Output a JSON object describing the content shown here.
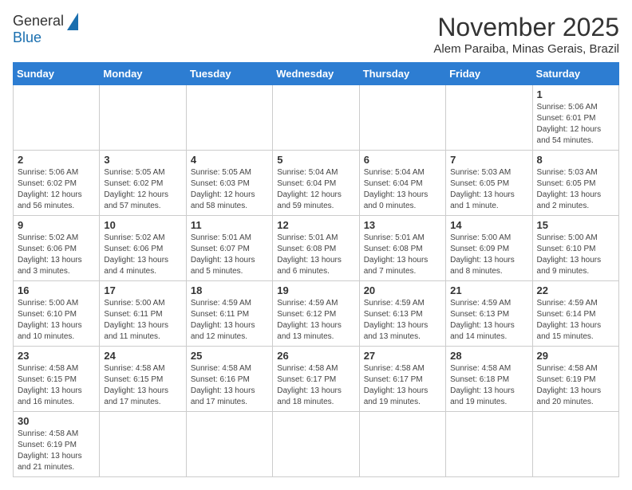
{
  "logo": {
    "line1": "General",
    "line2": "Blue"
  },
  "title": "November 2025",
  "subtitle": "Alem Paraiba, Minas Gerais, Brazil",
  "days_of_week": [
    "Sunday",
    "Monday",
    "Tuesday",
    "Wednesday",
    "Thursday",
    "Friday",
    "Saturday"
  ],
  "weeks": [
    [
      {
        "day": "",
        "info": ""
      },
      {
        "day": "",
        "info": ""
      },
      {
        "day": "",
        "info": ""
      },
      {
        "day": "",
        "info": ""
      },
      {
        "day": "",
        "info": ""
      },
      {
        "day": "",
        "info": ""
      },
      {
        "day": "1",
        "info": "Sunrise: 5:06 AM\nSunset: 6:01 PM\nDaylight: 12 hours\nand 54 minutes."
      }
    ],
    [
      {
        "day": "2",
        "info": "Sunrise: 5:06 AM\nSunset: 6:02 PM\nDaylight: 12 hours\nand 56 minutes."
      },
      {
        "day": "3",
        "info": "Sunrise: 5:05 AM\nSunset: 6:02 PM\nDaylight: 12 hours\nand 57 minutes."
      },
      {
        "day": "4",
        "info": "Sunrise: 5:05 AM\nSunset: 6:03 PM\nDaylight: 12 hours\nand 58 minutes."
      },
      {
        "day": "5",
        "info": "Sunrise: 5:04 AM\nSunset: 6:04 PM\nDaylight: 12 hours\nand 59 minutes."
      },
      {
        "day": "6",
        "info": "Sunrise: 5:04 AM\nSunset: 6:04 PM\nDaylight: 13 hours\nand 0 minutes."
      },
      {
        "day": "7",
        "info": "Sunrise: 5:03 AM\nSunset: 6:05 PM\nDaylight: 13 hours\nand 1 minute."
      },
      {
        "day": "8",
        "info": "Sunrise: 5:03 AM\nSunset: 6:05 PM\nDaylight: 13 hours\nand 2 minutes."
      }
    ],
    [
      {
        "day": "9",
        "info": "Sunrise: 5:02 AM\nSunset: 6:06 PM\nDaylight: 13 hours\nand 3 minutes."
      },
      {
        "day": "10",
        "info": "Sunrise: 5:02 AM\nSunset: 6:06 PM\nDaylight: 13 hours\nand 4 minutes."
      },
      {
        "day": "11",
        "info": "Sunrise: 5:01 AM\nSunset: 6:07 PM\nDaylight: 13 hours\nand 5 minutes."
      },
      {
        "day": "12",
        "info": "Sunrise: 5:01 AM\nSunset: 6:08 PM\nDaylight: 13 hours\nand 6 minutes."
      },
      {
        "day": "13",
        "info": "Sunrise: 5:01 AM\nSunset: 6:08 PM\nDaylight: 13 hours\nand 7 minutes."
      },
      {
        "day": "14",
        "info": "Sunrise: 5:00 AM\nSunset: 6:09 PM\nDaylight: 13 hours\nand 8 minutes."
      },
      {
        "day": "15",
        "info": "Sunrise: 5:00 AM\nSunset: 6:10 PM\nDaylight: 13 hours\nand 9 minutes."
      }
    ],
    [
      {
        "day": "16",
        "info": "Sunrise: 5:00 AM\nSunset: 6:10 PM\nDaylight: 13 hours\nand 10 minutes."
      },
      {
        "day": "17",
        "info": "Sunrise: 5:00 AM\nSunset: 6:11 PM\nDaylight: 13 hours\nand 11 minutes."
      },
      {
        "day": "18",
        "info": "Sunrise: 4:59 AM\nSunset: 6:11 PM\nDaylight: 13 hours\nand 12 minutes."
      },
      {
        "day": "19",
        "info": "Sunrise: 4:59 AM\nSunset: 6:12 PM\nDaylight: 13 hours\nand 13 minutes."
      },
      {
        "day": "20",
        "info": "Sunrise: 4:59 AM\nSunset: 6:13 PM\nDaylight: 13 hours\nand 13 minutes."
      },
      {
        "day": "21",
        "info": "Sunrise: 4:59 AM\nSunset: 6:13 PM\nDaylight: 13 hours\nand 14 minutes."
      },
      {
        "day": "22",
        "info": "Sunrise: 4:59 AM\nSunset: 6:14 PM\nDaylight: 13 hours\nand 15 minutes."
      }
    ],
    [
      {
        "day": "23",
        "info": "Sunrise: 4:58 AM\nSunset: 6:15 PM\nDaylight: 13 hours\nand 16 minutes."
      },
      {
        "day": "24",
        "info": "Sunrise: 4:58 AM\nSunset: 6:15 PM\nDaylight: 13 hours\nand 17 minutes."
      },
      {
        "day": "25",
        "info": "Sunrise: 4:58 AM\nSunset: 6:16 PM\nDaylight: 13 hours\nand 17 minutes."
      },
      {
        "day": "26",
        "info": "Sunrise: 4:58 AM\nSunset: 6:17 PM\nDaylight: 13 hours\nand 18 minutes."
      },
      {
        "day": "27",
        "info": "Sunrise: 4:58 AM\nSunset: 6:17 PM\nDaylight: 13 hours\nand 19 minutes."
      },
      {
        "day": "28",
        "info": "Sunrise: 4:58 AM\nSunset: 6:18 PM\nDaylight: 13 hours\nand 19 minutes."
      },
      {
        "day": "29",
        "info": "Sunrise: 4:58 AM\nSunset: 6:19 PM\nDaylight: 13 hours\nand 20 minutes."
      }
    ],
    [
      {
        "day": "30",
        "info": "Sunrise: 4:58 AM\nSunset: 6:19 PM\nDaylight: 13 hours\nand 21 minutes."
      },
      {
        "day": "",
        "info": ""
      },
      {
        "day": "",
        "info": ""
      },
      {
        "day": "",
        "info": ""
      },
      {
        "day": "",
        "info": ""
      },
      {
        "day": "",
        "info": ""
      },
      {
        "day": "",
        "info": ""
      }
    ]
  ]
}
